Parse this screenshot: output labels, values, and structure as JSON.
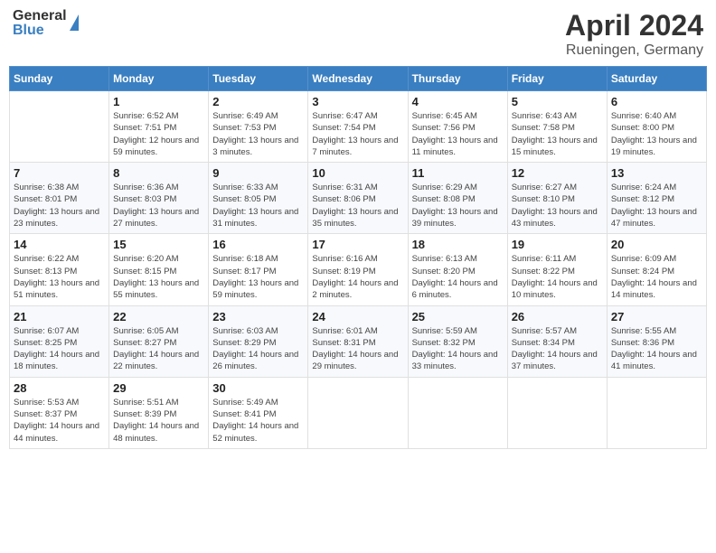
{
  "header": {
    "logo_general": "General",
    "logo_blue": "Blue",
    "month": "April 2024",
    "location": "Rueningen, Germany"
  },
  "days_of_week": [
    "Sunday",
    "Monday",
    "Tuesday",
    "Wednesday",
    "Thursday",
    "Friday",
    "Saturday"
  ],
  "weeks": [
    [
      {
        "day": "",
        "sunrise": "",
        "sunset": "",
        "daylight": ""
      },
      {
        "day": "1",
        "sunrise": "Sunrise: 6:52 AM",
        "sunset": "Sunset: 7:51 PM",
        "daylight": "Daylight: 12 hours and 59 minutes."
      },
      {
        "day": "2",
        "sunrise": "Sunrise: 6:49 AM",
        "sunset": "Sunset: 7:53 PM",
        "daylight": "Daylight: 13 hours and 3 minutes."
      },
      {
        "day": "3",
        "sunrise": "Sunrise: 6:47 AM",
        "sunset": "Sunset: 7:54 PM",
        "daylight": "Daylight: 13 hours and 7 minutes."
      },
      {
        "day": "4",
        "sunrise": "Sunrise: 6:45 AM",
        "sunset": "Sunset: 7:56 PM",
        "daylight": "Daylight: 13 hours and 11 minutes."
      },
      {
        "day": "5",
        "sunrise": "Sunrise: 6:43 AM",
        "sunset": "Sunset: 7:58 PM",
        "daylight": "Daylight: 13 hours and 15 minutes."
      },
      {
        "day": "6",
        "sunrise": "Sunrise: 6:40 AM",
        "sunset": "Sunset: 8:00 PM",
        "daylight": "Daylight: 13 hours and 19 minutes."
      }
    ],
    [
      {
        "day": "7",
        "sunrise": "Sunrise: 6:38 AM",
        "sunset": "Sunset: 8:01 PM",
        "daylight": "Daylight: 13 hours and 23 minutes."
      },
      {
        "day": "8",
        "sunrise": "Sunrise: 6:36 AM",
        "sunset": "Sunset: 8:03 PM",
        "daylight": "Daylight: 13 hours and 27 minutes."
      },
      {
        "day": "9",
        "sunrise": "Sunrise: 6:33 AM",
        "sunset": "Sunset: 8:05 PM",
        "daylight": "Daylight: 13 hours and 31 minutes."
      },
      {
        "day": "10",
        "sunrise": "Sunrise: 6:31 AM",
        "sunset": "Sunset: 8:06 PM",
        "daylight": "Daylight: 13 hours and 35 minutes."
      },
      {
        "day": "11",
        "sunrise": "Sunrise: 6:29 AM",
        "sunset": "Sunset: 8:08 PM",
        "daylight": "Daylight: 13 hours and 39 minutes."
      },
      {
        "day": "12",
        "sunrise": "Sunrise: 6:27 AM",
        "sunset": "Sunset: 8:10 PM",
        "daylight": "Daylight: 13 hours and 43 minutes."
      },
      {
        "day": "13",
        "sunrise": "Sunrise: 6:24 AM",
        "sunset": "Sunset: 8:12 PM",
        "daylight": "Daylight: 13 hours and 47 minutes."
      }
    ],
    [
      {
        "day": "14",
        "sunrise": "Sunrise: 6:22 AM",
        "sunset": "Sunset: 8:13 PM",
        "daylight": "Daylight: 13 hours and 51 minutes."
      },
      {
        "day": "15",
        "sunrise": "Sunrise: 6:20 AM",
        "sunset": "Sunset: 8:15 PM",
        "daylight": "Daylight: 13 hours and 55 minutes."
      },
      {
        "day": "16",
        "sunrise": "Sunrise: 6:18 AM",
        "sunset": "Sunset: 8:17 PM",
        "daylight": "Daylight: 13 hours and 59 minutes."
      },
      {
        "day": "17",
        "sunrise": "Sunrise: 6:16 AM",
        "sunset": "Sunset: 8:19 PM",
        "daylight": "Daylight: 14 hours and 2 minutes."
      },
      {
        "day": "18",
        "sunrise": "Sunrise: 6:13 AM",
        "sunset": "Sunset: 8:20 PM",
        "daylight": "Daylight: 14 hours and 6 minutes."
      },
      {
        "day": "19",
        "sunrise": "Sunrise: 6:11 AM",
        "sunset": "Sunset: 8:22 PM",
        "daylight": "Daylight: 14 hours and 10 minutes."
      },
      {
        "day": "20",
        "sunrise": "Sunrise: 6:09 AM",
        "sunset": "Sunset: 8:24 PM",
        "daylight": "Daylight: 14 hours and 14 minutes."
      }
    ],
    [
      {
        "day": "21",
        "sunrise": "Sunrise: 6:07 AM",
        "sunset": "Sunset: 8:25 PM",
        "daylight": "Daylight: 14 hours and 18 minutes."
      },
      {
        "day": "22",
        "sunrise": "Sunrise: 6:05 AM",
        "sunset": "Sunset: 8:27 PM",
        "daylight": "Daylight: 14 hours and 22 minutes."
      },
      {
        "day": "23",
        "sunrise": "Sunrise: 6:03 AM",
        "sunset": "Sunset: 8:29 PM",
        "daylight": "Daylight: 14 hours and 26 minutes."
      },
      {
        "day": "24",
        "sunrise": "Sunrise: 6:01 AM",
        "sunset": "Sunset: 8:31 PM",
        "daylight": "Daylight: 14 hours and 29 minutes."
      },
      {
        "day": "25",
        "sunrise": "Sunrise: 5:59 AM",
        "sunset": "Sunset: 8:32 PM",
        "daylight": "Daylight: 14 hours and 33 minutes."
      },
      {
        "day": "26",
        "sunrise": "Sunrise: 5:57 AM",
        "sunset": "Sunset: 8:34 PM",
        "daylight": "Daylight: 14 hours and 37 minutes."
      },
      {
        "day": "27",
        "sunrise": "Sunrise: 5:55 AM",
        "sunset": "Sunset: 8:36 PM",
        "daylight": "Daylight: 14 hours and 41 minutes."
      }
    ],
    [
      {
        "day": "28",
        "sunrise": "Sunrise: 5:53 AM",
        "sunset": "Sunset: 8:37 PM",
        "daylight": "Daylight: 14 hours and 44 minutes."
      },
      {
        "day": "29",
        "sunrise": "Sunrise: 5:51 AM",
        "sunset": "Sunset: 8:39 PM",
        "daylight": "Daylight: 14 hours and 48 minutes."
      },
      {
        "day": "30",
        "sunrise": "Sunrise: 5:49 AM",
        "sunset": "Sunset: 8:41 PM",
        "daylight": "Daylight: 14 hours and 52 minutes."
      },
      {
        "day": "",
        "sunrise": "",
        "sunset": "",
        "daylight": ""
      },
      {
        "day": "",
        "sunrise": "",
        "sunset": "",
        "daylight": ""
      },
      {
        "day": "",
        "sunrise": "",
        "sunset": "",
        "daylight": ""
      },
      {
        "day": "",
        "sunrise": "",
        "sunset": "",
        "daylight": ""
      }
    ]
  ]
}
